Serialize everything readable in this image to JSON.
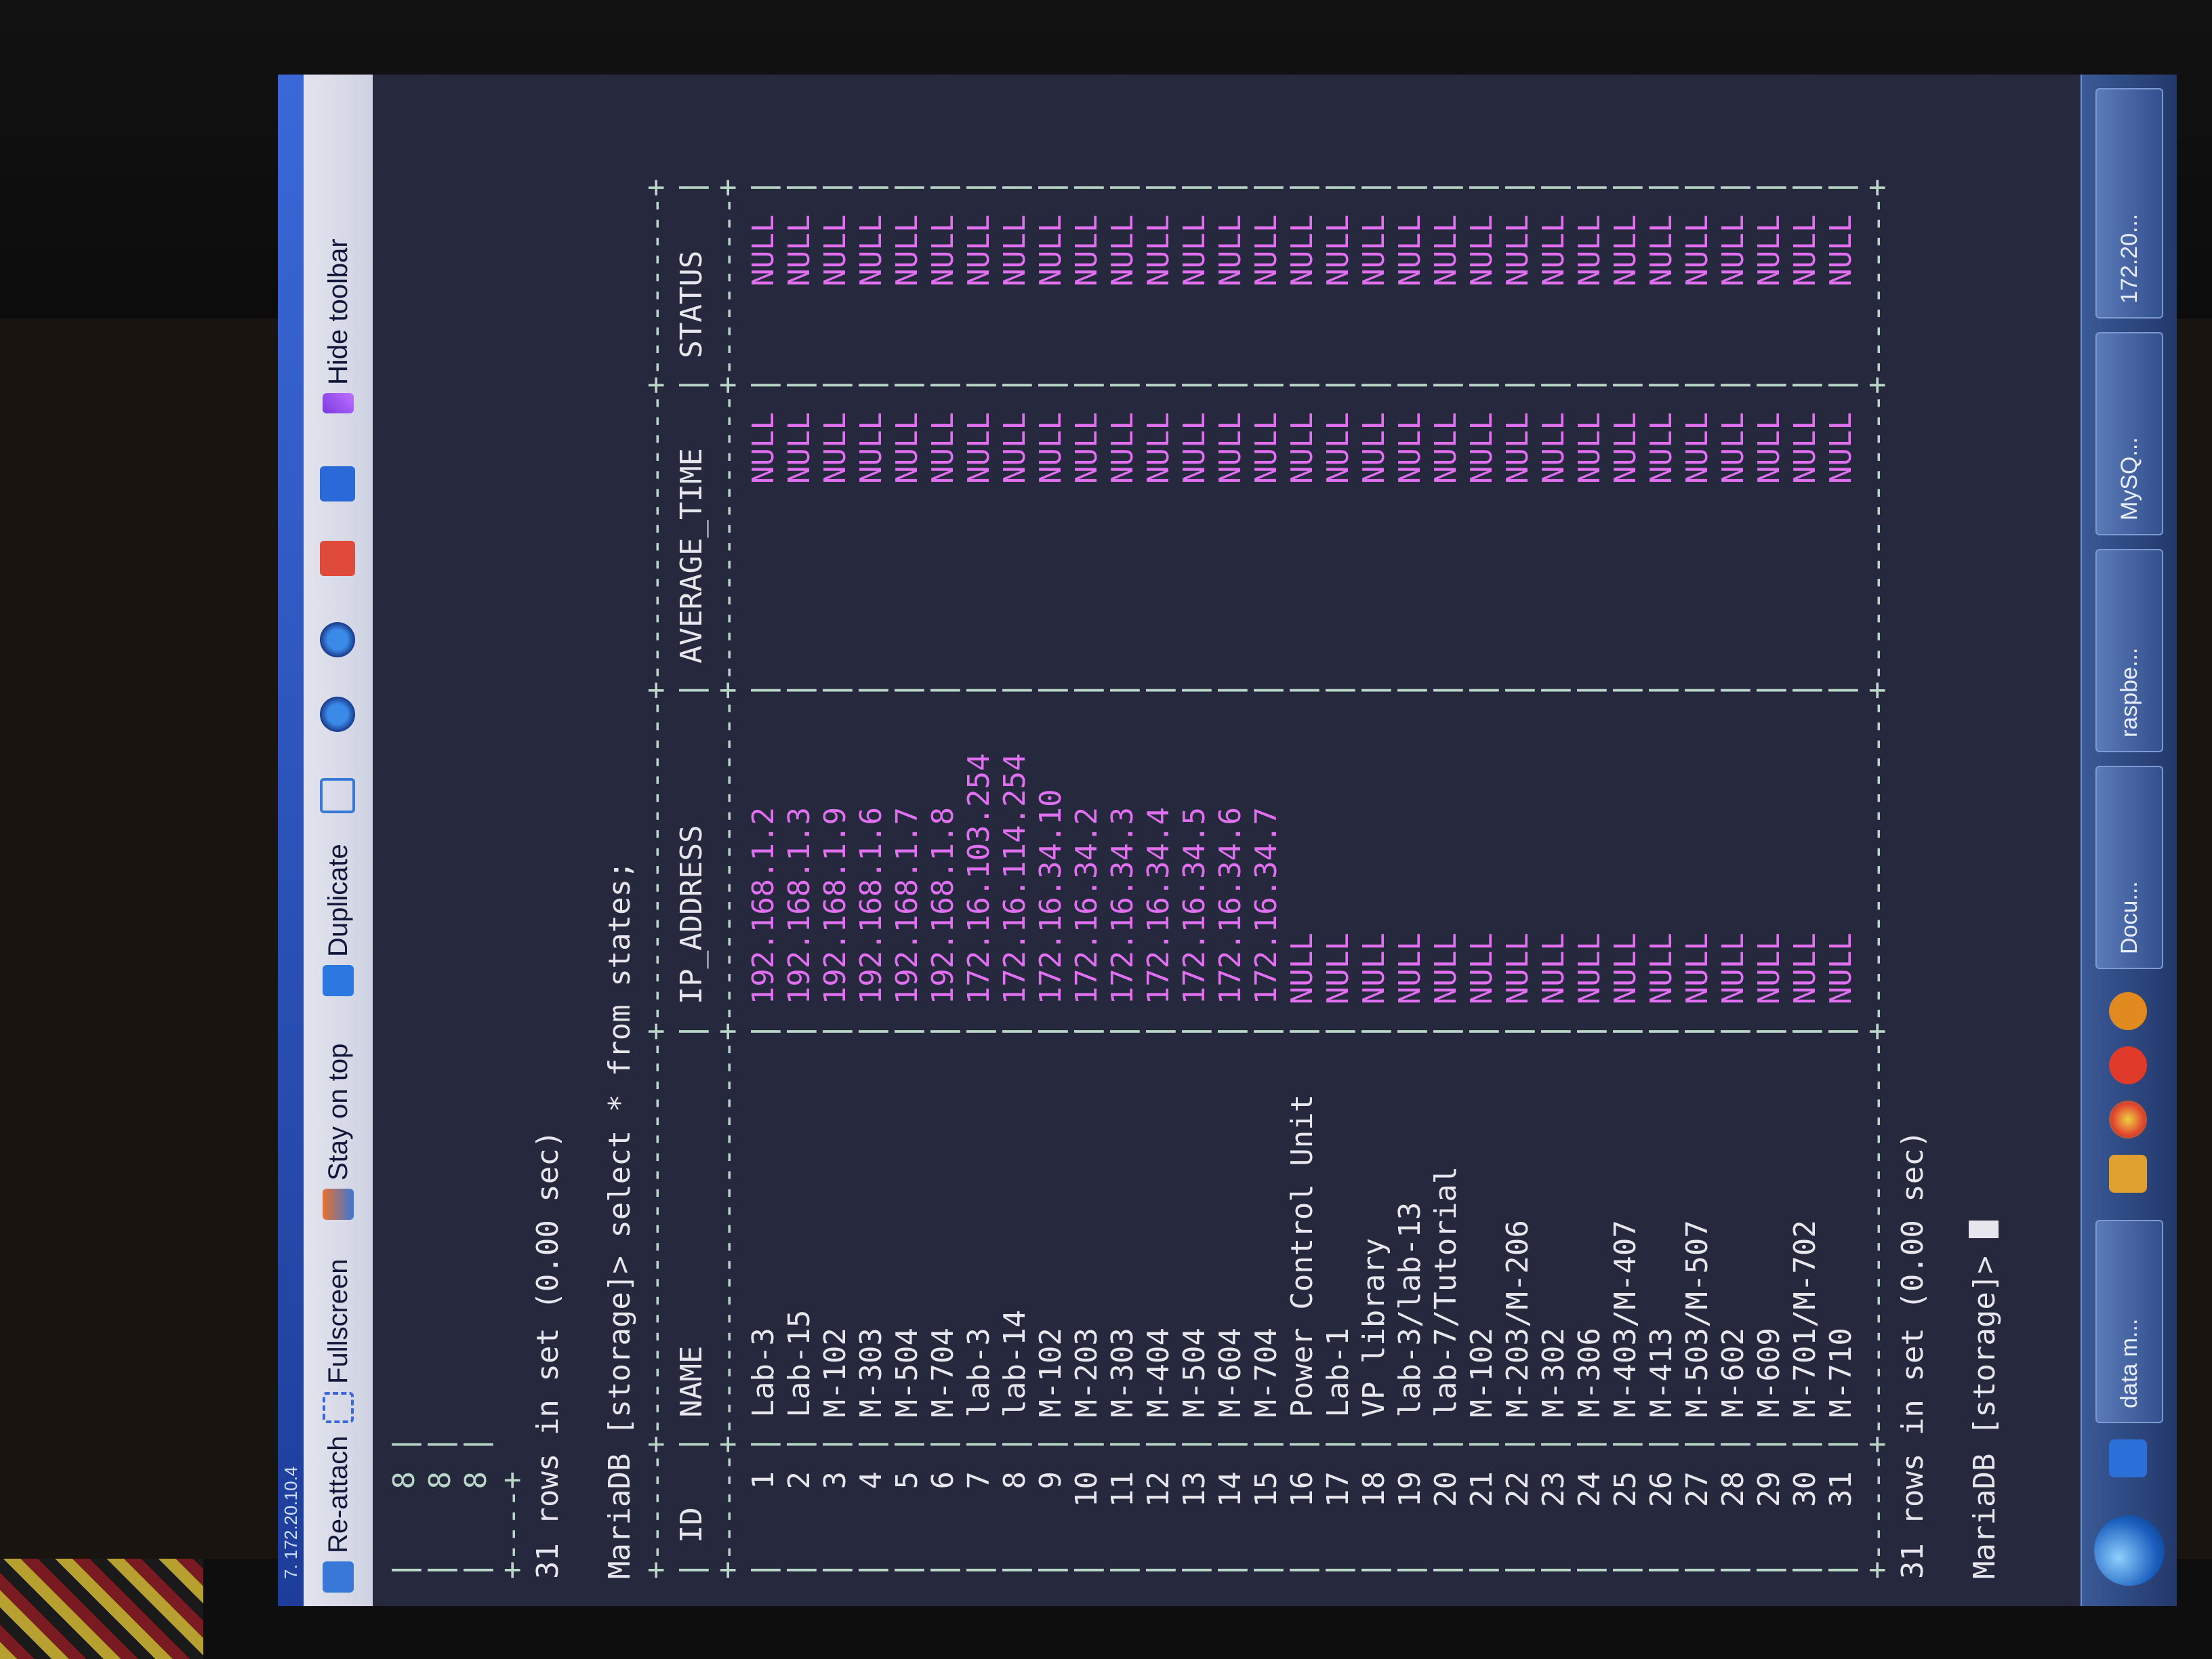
{
  "window": {
    "title": "7. 172.20.10.4"
  },
  "toolbar": {
    "reattach": "Re-attach",
    "fullscreen": "Fullscreen",
    "stay_on_top": "Stay on top",
    "duplicate": "Duplicate",
    "hide_toolbar": "Hide toolbar"
  },
  "terminal": {
    "prev_rows": [
      "8",
      "8",
      "8"
    ],
    "prev_result": "31 rows in set (0.00 sec)",
    "prompt": "MariaDB [storage]>",
    "command": "select * from states;",
    "columns": [
      "ID",
      "NAME",
      "IP_ADDRESS",
      "AVERAGE_TIME",
      "STATUS"
    ],
    "rows": [
      {
        "id": "1",
        "name": "Lab-3",
        "ip": "192.168.1.2",
        "avg": "NULL",
        "status": "NULL"
      },
      {
        "id": "2",
        "name": "Lab-15",
        "ip": "192.168.1.3",
        "avg": "NULL",
        "status": "NULL"
      },
      {
        "id": "3",
        "name": "M-102",
        "ip": "192.168.1.9",
        "avg": "NULL",
        "status": "NULL"
      },
      {
        "id": "4",
        "name": "M-303",
        "ip": "192.168.1.6",
        "avg": "NULL",
        "status": "NULL"
      },
      {
        "id": "5",
        "name": "M-504",
        "ip": "192.168.1.7",
        "avg": "NULL",
        "status": "NULL"
      },
      {
        "id": "6",
        "name": "M-704",
        "ip": "192.168.1.8",
        "avg": "NULL",
        "status": "NULL"
      },
      {
        "id": "7",
        "name": "lab-3",
        "ip": "172.16.103.254",
        "avg": "NULL",
        "status": "NULL"
      },
      {
        "id": "8",
        "name": "lab-14",
        "ip": "172.16.114.254",
        "avg": "NULL",
        "status": "NULL"
      },
      {
        "id": "9",
        "name": "M-102",
        "ip": "172.16.34.10",
        "avg": "NULL",
        "status": "NULL"
      },
      {
        "id": "10",
        "name": "M-203",
        "ip": "172.16.34.2",
        "avg": "NULL",
        "status": "NULL"
      },
      {
        "id": "11",
        "name": "M-303",
        "ip": "172.16.34.3",
        "avg": "NULL",
        "status": "NULL"
      },
      {
        "id": "12",
        "name": "M-404",
        "ip": "172.16.34.4",
        "avg": "NULL",
        "status": "NULL"
      },
      {
        "id": "13",
        "name": "M-504",
        "ip": "172.16.34.5",
        "avg": "NULL",
        "status": "NULL"
      },
      {
        "id": "14",
        "name": "M-604",
        "ip": "172.16.34.6",
        "avg": "NULL",
        "status": "NULL"
      },
      {
        "id": "15",
        "name": "M-704",
        "ip": "172.16.34.7",
        "avg": "NULL",
        "status": "NULL"
      },
      {
        "id": "16",
        "name": "Power Control Unit",
        "ip": "NULL",
        "avg": "NULL",
        "status": "NULL"
      },
      {
        "id": "17",
        "name": "Lab-1",
        "ip": "NULL",
        "avg": "NULL",
        "status": "NULL"
      },
      {
        "id": "18",
        "name": "VP library",
        "ip": "NULL",
        "avg": "NULL",
        "status": "NULL"
      },
      {
        "id": "19",
        "name": "lab-3/lab-13",
        "ip": "NULL",
        "avg": "NULL",
        "status": "NULL"
      },
      {
        "id": "20",
        "name": "lab-7/Tutorial",
        "ip": "NULL",
        "avg": "NULL",
        "status": "NULL"
      },
      {
        "id": "21",
        "name": "M-102",
        "ip": "NULL",
        "avg": "NULL",
        "status": "NULL"
      },
      {
        "id": "22",
        "name": "M-203/M-206",
        "ip": "NULL",
        "avg": "NULL",
        "status": "NULL"
      },
      {
        "id": "23",
        "name": "M-302",
        "ip": "NULL",
        "avg": "NULL",
        "status": "NULL"
      },
      {
        "id": "24",
        "name": "M-306",
        "ip": "NULL",
        "avg": "NULL",
        "status": "NULL"
      },
      {
        "id": "25",
        "name": "M-403/M-407",
        "ip": "NULL",
        "avg": "NULL",
        "status": "NULL"
      },
      {
        "id": "26",
        "name": "M-413",
        "ip": "NULL",
        "avg": "NULL",
        "status": "NULL"
      },
      {
        "id": "27",
        "name": "M-503/M-507",
        "ip": "NULL",
        "avg": "NULL",
        "status": "NULL"
      },
      {
        "id": "28",
        "name": "M-602",
        "ip": "NULL",
        "avg": "NULL",
        "status": "NULL"
      },
      {
        "id": "29",
        "name": "M-609",
        "ip": "NULL",
        "avg": "NULL",
        "status": "NULL"
      },
      {
        "id": "30",
        "name": "M-701/M-702",
        "ip": "NULL",
        "avg": "NULL",
        "status": "NULL"
      },
      {
        "id": "31",
        "name": "M-710",
        "ip": "NULL",
        "avg": "NULL",
        "status": "NULL"
      }
    ],
    "result": "31 rows in set (0.00 sec)",
    "final_prompt": "MariaDB [storage]>"
  },
  "taskbar": {
    "tasks": [
      "data m...",
      "Docu...",
      "raspbe...",
      "MySQ...",
      "172.20..."
    ]
  },
  "colors": {
    "terminal_bg": "#26283e",
    "value_color": "#e070f0",
    "separator_color": "#b9d7c6",
    "text_color": "#e6e6ec"
  }
}
